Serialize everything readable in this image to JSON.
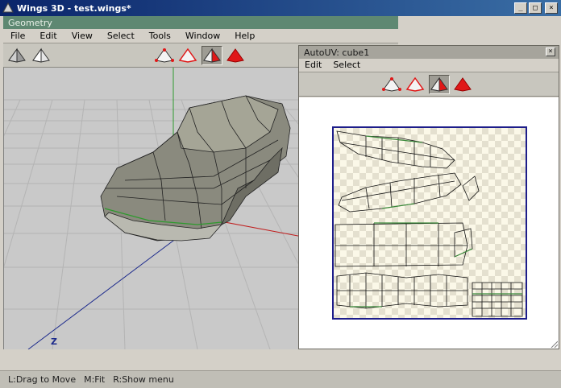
{
  "os_window": {
    "title": "Wings 3D - test.wings*",
    "buttons": {
      "minimize": "_",
      "maximize": "□",
      "close": "×"
    }
  },
  "geometry_window": {
    "title": "Geometry",
    "menu": [
      "File",
      "Edit",
      "View",
      "Select",
      "Tools",
      "Window",
      "Help"
    ],
    "viewport": {
      "axis_label": "Z"
    }
  },
  "autouv_window": {
    "title": "AutoUV: cube1",
    "close": "×",
    "menu": [
      "Edit",
      "Select"
    ]
  },
  "statusbar": {
    "drag": "L:Drag to Move",
    "fit": "M:Fit",
    "menu": "R:Show menu"
  },
  "icons": {
    "view_modes": [
      "smooth-cube-icon",
      "flat-cube-icon"
    ],
    "selection_modes": [
      "vertex-mode-icon",
      "edge-mode-icon",
      "face-mode-icon",
      "body-mode-icon"
    ]
  },
  "colors": {
    "geometry_title_bg": "#5e8872",
    "autouv_title_bg": "#a6a49c",
    "selection_red": "#e01818",
    "uv_border": "#1d1d8a",
    "uv_edge_selected": "#3a8a3a"
  }
}
